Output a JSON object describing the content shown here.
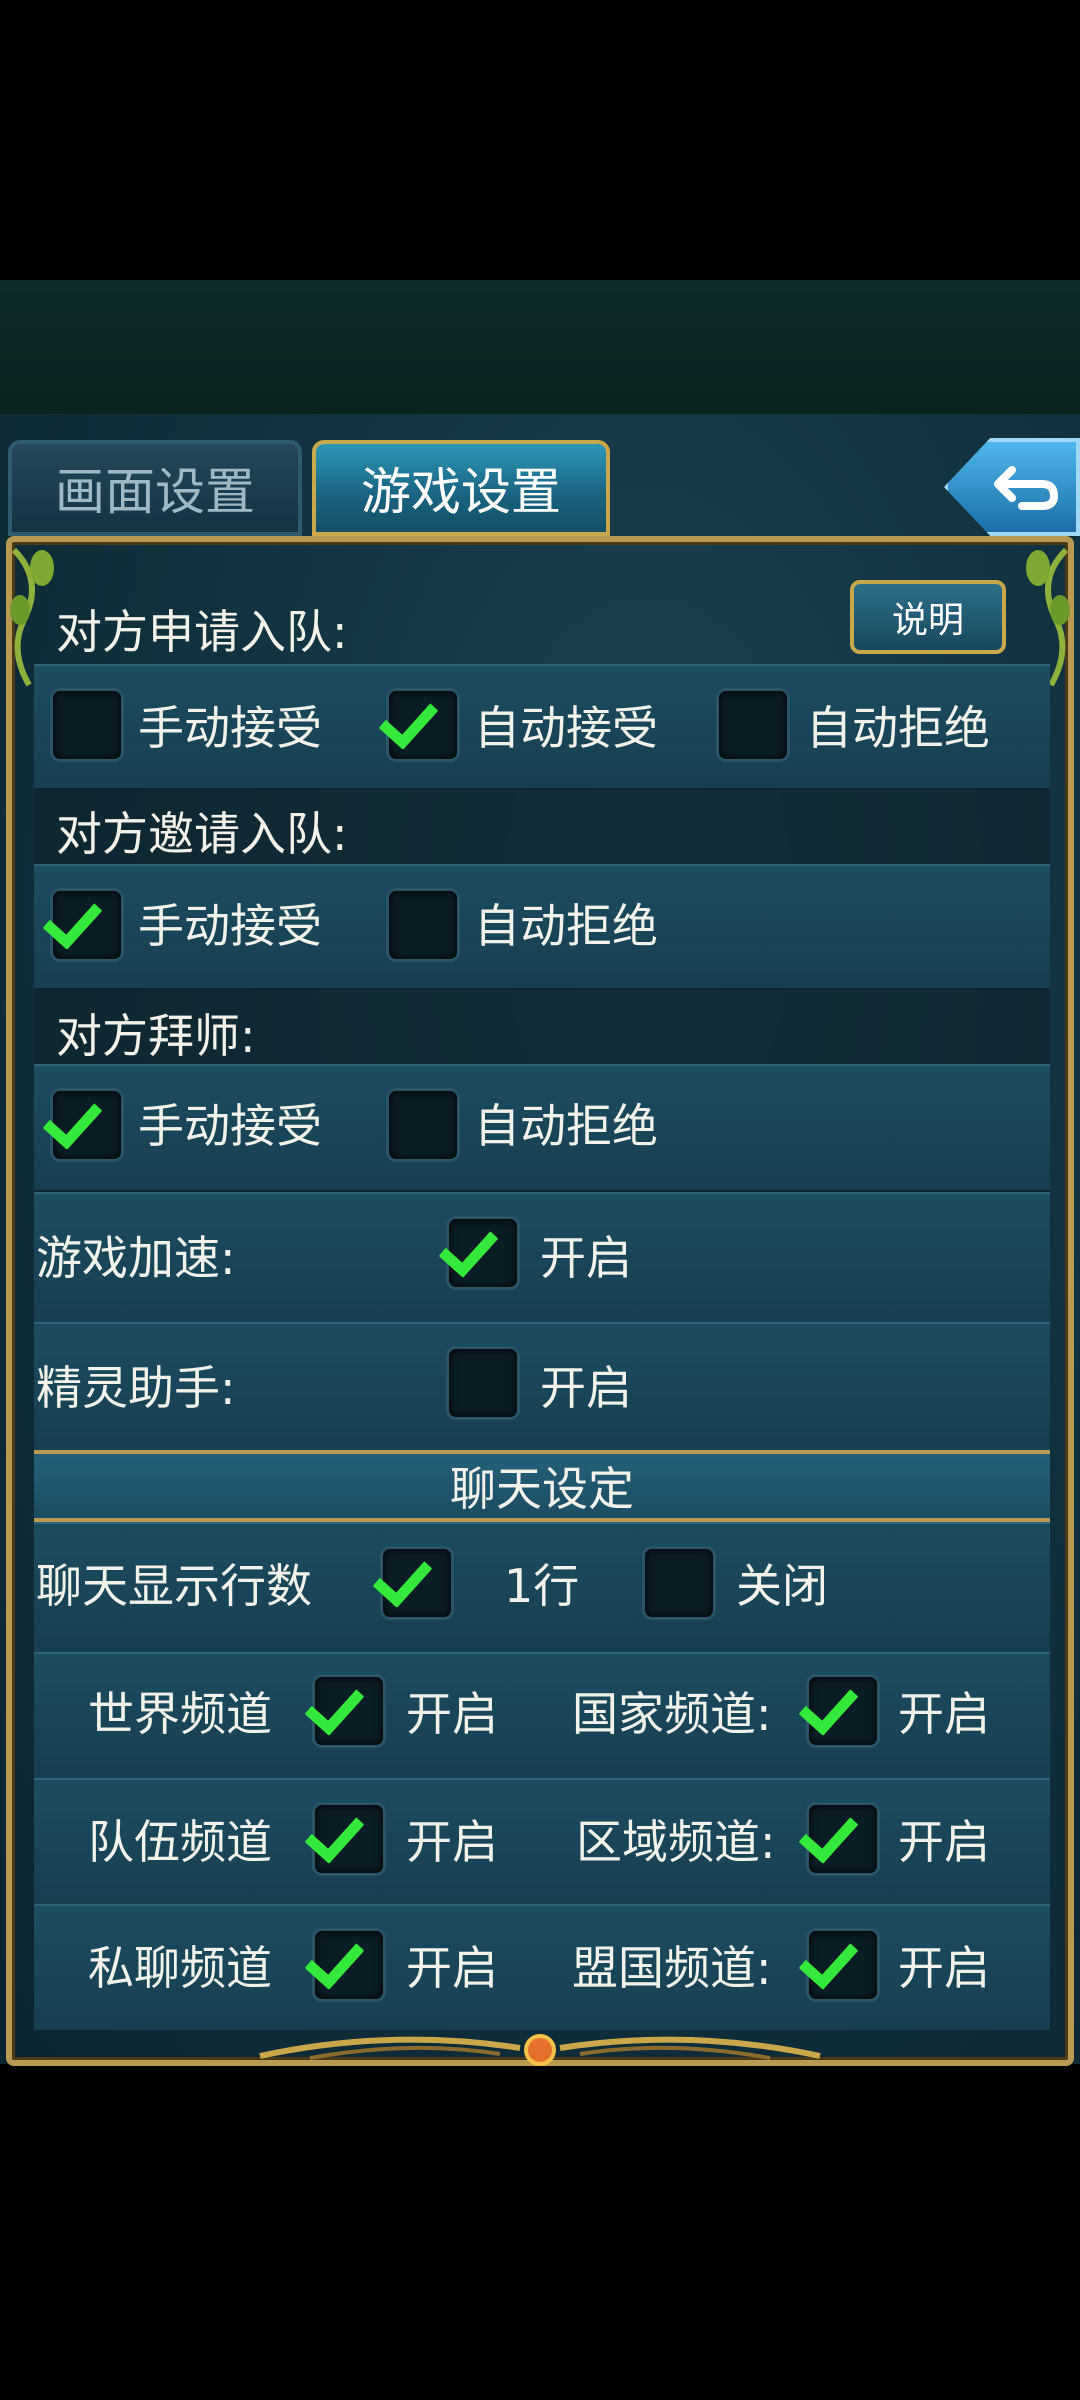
{
  "tabs": {
    "display": "画面设置",
    "game": "游戏设置"
  },
  "explain_button": "说明",
  "team_apply": {
    "title": "对方申请入队:",
    "options": [
      {
        "label": "手动接受",
        "checked": false
      },
      {
        "label": "自动接受",
        "checked": true
      },
      {
        "label": "自动拒绝",
        "checked": false
      }
    ]
  },
  "team_invite": {
    "title": "对方邀请入队:",
    "options": [
      {
        "label": "手动接受",
        "checked": true
      },
      {
        "label": "自动拒绝",
        "checked": false
      }
    ]
  },
  "apprentice": {
    "title": "对方拜师:",
    "options": [
      {
        "label": "手动接受",
        "checked": true
      },
      {
        "label": "自动拒绝",
        "checked": false
      }
    ]
  },
  "game_speedup": {
    "label": "游戏加速:",
    "option": "开启",
    "checked": true
  },
  "sprite_helper": {
    "label": "精灵助手:",
    "option": "开启",
    "checked": false
  },
  "chat_section": {
    "title": "聊天设定",
    "lines_label": "聊天显示行数",
    "lines_option_1": "1行",
    "lines_option_1_checked": true,
    "lines_option_2": "关闭",
    "lines_option_2_checked": false,
    "channels": [
      {
        "left": "世界频道",
        "left_on": "开启",
        "right": "国家频道:",
        "right_on": "开启"
      },
      {
        "left": "队伍频道",
        "left_on": "开启",
        "right": "区域频道:",
        "right_on": "开启"
      },
      {
        "left": "私聊频道",
        "left_on": "开启",
        "right": "盟国频道:",
        "right_on": "开启"
      }
    ]
  },
  "colors": {
    "check": "#35e83c",
    "gold": "#b89a52",
    "panel": "#1b4d60"
  }
}
